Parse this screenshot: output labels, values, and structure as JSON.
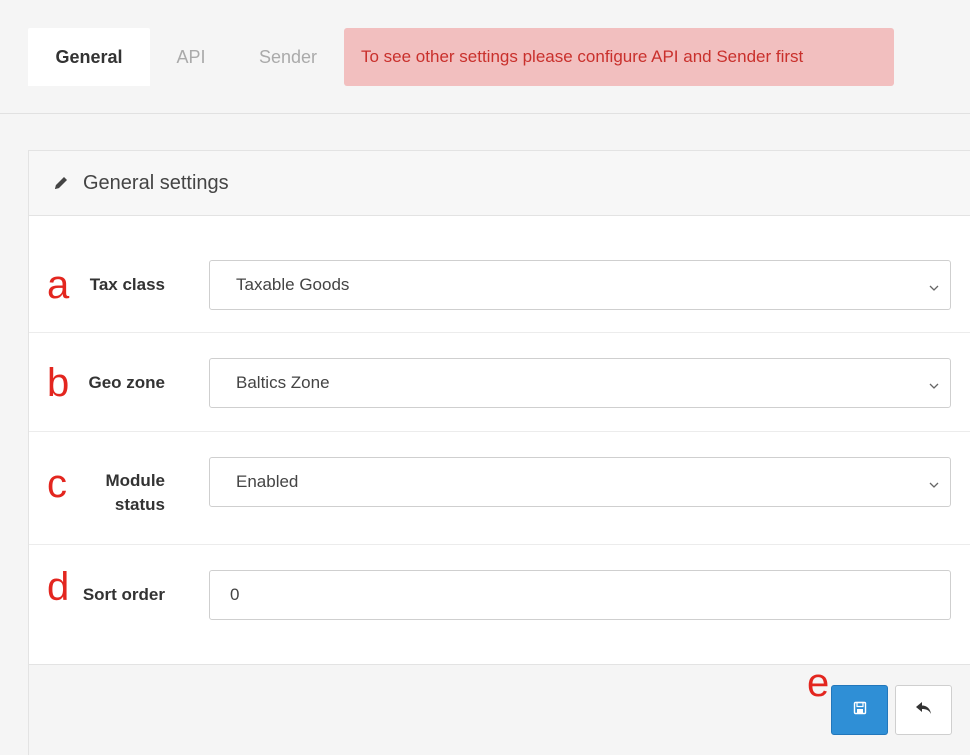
{
  "tabs": [
    {
      "label": "General",
      "active": true
    },
    {
      "label": "API",
      "active": false
    },
    {
      "label": "Sender",
      "active": false
    }
  ],
  "alert": {
    "text": "To see other settings please configure API and Sender first",
    "color": "#c9302c",
    "background": "#f2bfbf"
  },
  "panel": {
    "heading": "General settings",
    "heading_icon": "pencil-icon"
  },
  "fields": {
    "tax_class": {
      "marker": "a",
      "label": "Tax class",
      "value": "Taxable Goods",
      "type": "select"
    },
    "geo_zone": {
      "marker": "b",
      "label": "Geo zone",
      "value": "Baltics Zone",
      "type": "select"
    },
    "module_status": {
      "marker": "c",
      "label_line1": "Module",
      "label_line2": "status",
      "value": "Enabled",
      "type": "select"
    },
    "sort_order": {
      "marker": "d",
      "label": "Sort order",
      "value": "0",
      "type": "text"
    }
  },
  "footer": {
    "marker": "e",
    "save_icon": "floppy-disk-icon",
    "back_icon": "reply-arrow-icon",
    "save_color": "#2f8fd6"
  },
  "annotation_color": "#e3261f"
}
